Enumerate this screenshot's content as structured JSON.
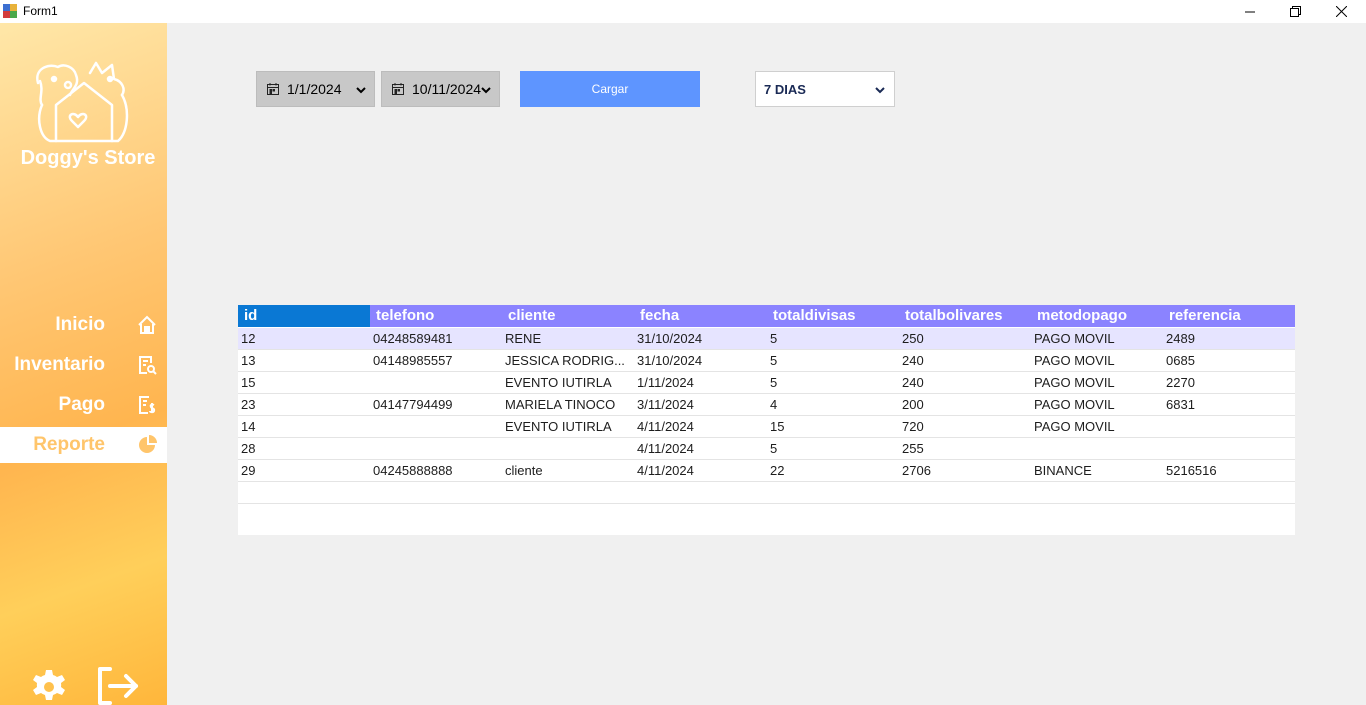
{
  "window": {
    "title": "Form1"
  },
  "sidebar": {
    "brand": "Doggy's Store",
    "nav": [
      {
        "label": "Inicio",
        "icon": "home-icon"
      },
      {
        "label": "Inventario",
        "icon": "inventory-search-icon"
      },
      {
        "label": "Pago",
        "icon": "payment-document-icon"
      },
      {
        "label": "Reporte",
        "icon": "pie-chart-icon",
        "active": true
      }
    ],
    "bottom_icons": [
      "gear-icon",
      "logout-icon"
    ]
  },
  "controls": {
    "date_from": "1/1/2024",
    "date_to": "10/11/2024",
    "load_button": "Cargar",
    "range_select": "7 DIAS"
  },
  "table": {
    "columns": [
      "id",
      "telefono",
      "cliente",
      "fecha",
      "totaldivisas",
      "totalbolivares",
      "metodopago",
      "referencia"
    ],
    "rows": [
      [
        "12",
        "04248589481",
        "RENE",
        "31/10/2024",
        "5",
        "250",
        "PAGO MOVIL",
        "2489"
      ],
      [
        "13",
        "04148985557",
        "JESSICA RODRIG...",
        "31/10/2024",
        "5",
        "240",
        "PAGO MOVIL",
        "0685"
      ],
      [
        "15",
        "",
        "EVENTO IUTIRLA",
        "1/11/2024",
        "5",
        "240",
        "PAGO MOVIL",
        "2270"
      ],
      [
        "23",
        "04147794499",
        "MARIELA TINOCO",
        "3/11/2024",
        "4",
        "200",
        "PAGO MOVIL",
        "6831"
      ],
      [
        "14",
        "",
        "EVENTO IUTIRLA",
        "4/11/2024",
        "15",
        "720",
        "PAGO MOVIL",
        ""
      ],
      [
        "28",
        "",
        "",
        "4/11/2024",
        "5",
        "255",
        "",
        ""
      ],
      [
        "29",
        "04245888888",
        "cliente",
        "4/11/2024",
        "22",
        "2706",
        "BINANCE",
        "5216516"
      ]
    ]
  },
  "colors": {
    "header_bg": "#8b83ff",
    "selected_header": "#0a78d4",
    "accent_button": "#5e95ff",
    "sidebar_orange": "#ffb54f",
    "active_nav_text": "#ffc56b"
  }
}
